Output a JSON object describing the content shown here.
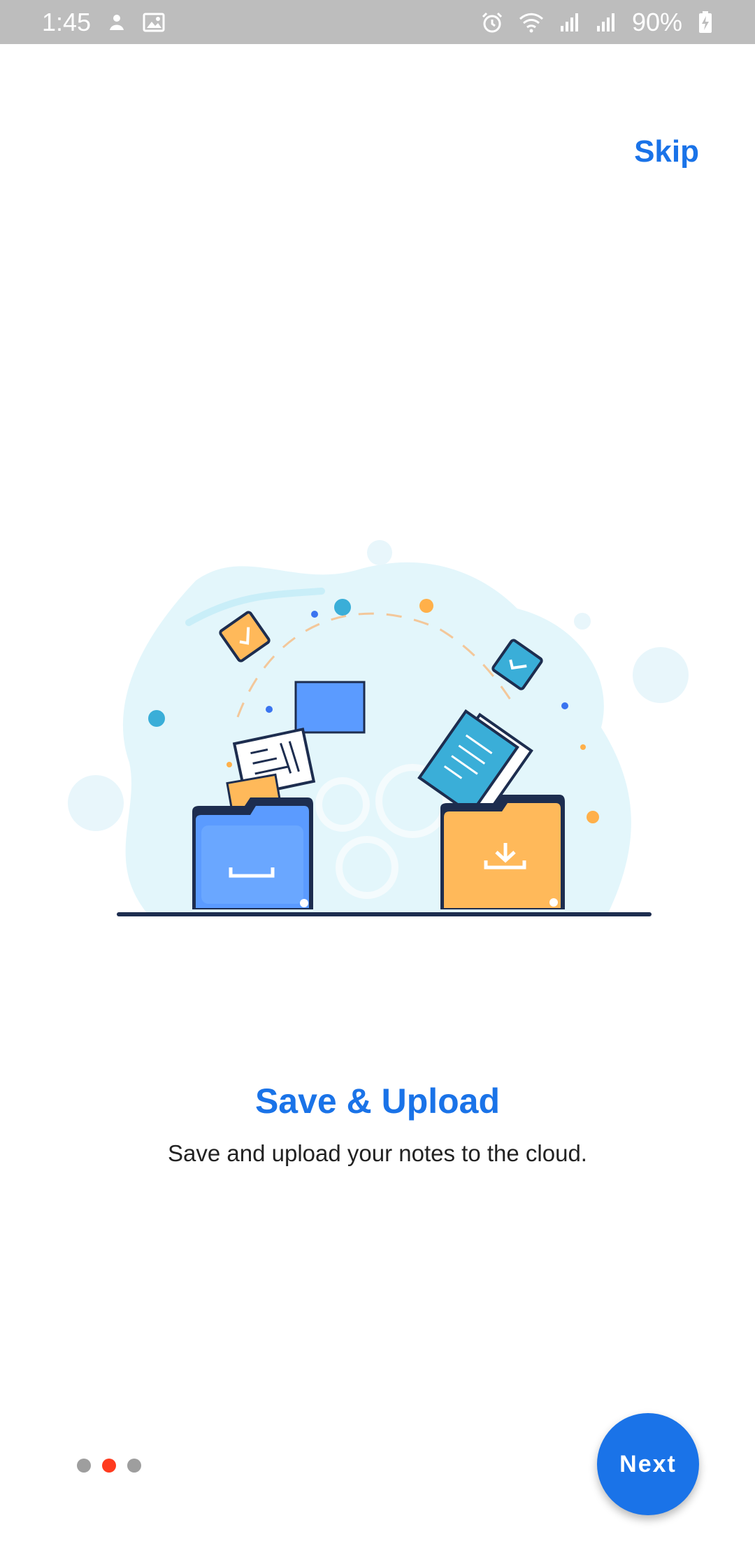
{
  "status_bar": {
    "time": "1:45",
    "battery": "90%",
    "icons": [
      "notification-icon",
      "image-icon",
      "alarm-icon",
      "wifi-icon",
      "signal-icon",
      "signal-icon",
      "battery-icon"
    ]
  },
  "header": {
    "skip_label": "Skip"
  },
  "onboarding": {
    "title": "Save & Upload",
    "description": "Save and upload your notes to the cloud.",
    "page_indicator": {
      "total": 3,
      "active_index": 1
    }
  },
  "footer": {
    "next_label": "Next"
  },
  "colors": {
    "accent": "#1a73e8",
    "active_dot": "#ff3b1f",
    "inactive_dot": "#9e9e9e",
    "folder_blue": "#5b9bff",
    "folder_orange": "#ffb95a"
  }
}
